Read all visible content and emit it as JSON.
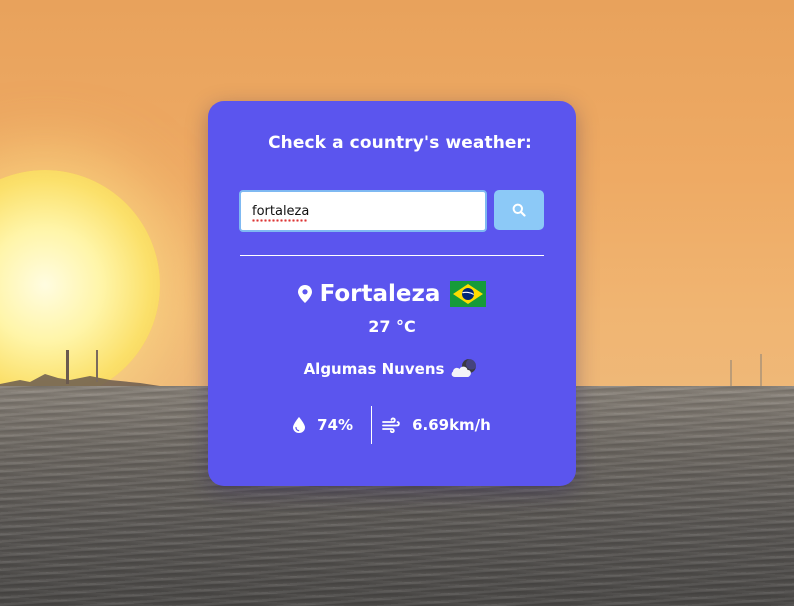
{
  "title": "Check a country's weather:",
  "search": {
    "value": "fortaleza",
    "placeholder": ""
  },
  "result": {
    "city": "Fortaleza",
    "country_flag": "Brazil flag",
    "temperature": "27 °C",
    "description": "Algumas Nuvens",
    "weather_icon": "partly-cloudy-night-icon",
    "humidity": "74%",
    "wind": "6.69km/h"
  },
  "colors": {
    "card": "#5b55ee",
    "button": "#8cc9f7",
    "text": "#ffffff"
  }
}
